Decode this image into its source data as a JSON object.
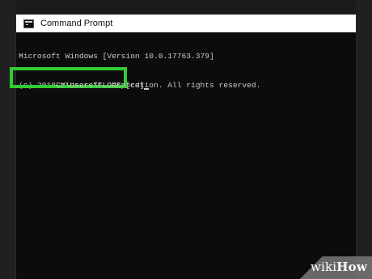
{
  "window": {
    "title": "Command Prompt",
    "icon": "cmd-icon"
  },
  "console": {
    "lines": [
      "Microsoft Windows [Version 10.0.17763.379]",
      "(c) 2018 Microsoft Corporation. All rights reserved."
    ],
    "prompt": "C:\\Users\\FLORE>[cd]"
  },
  "highlight": {
    "color": "#33cc33"
  },
  "watermark": {
    "wiki": "wiki",
    "how": "How"
  }
}
